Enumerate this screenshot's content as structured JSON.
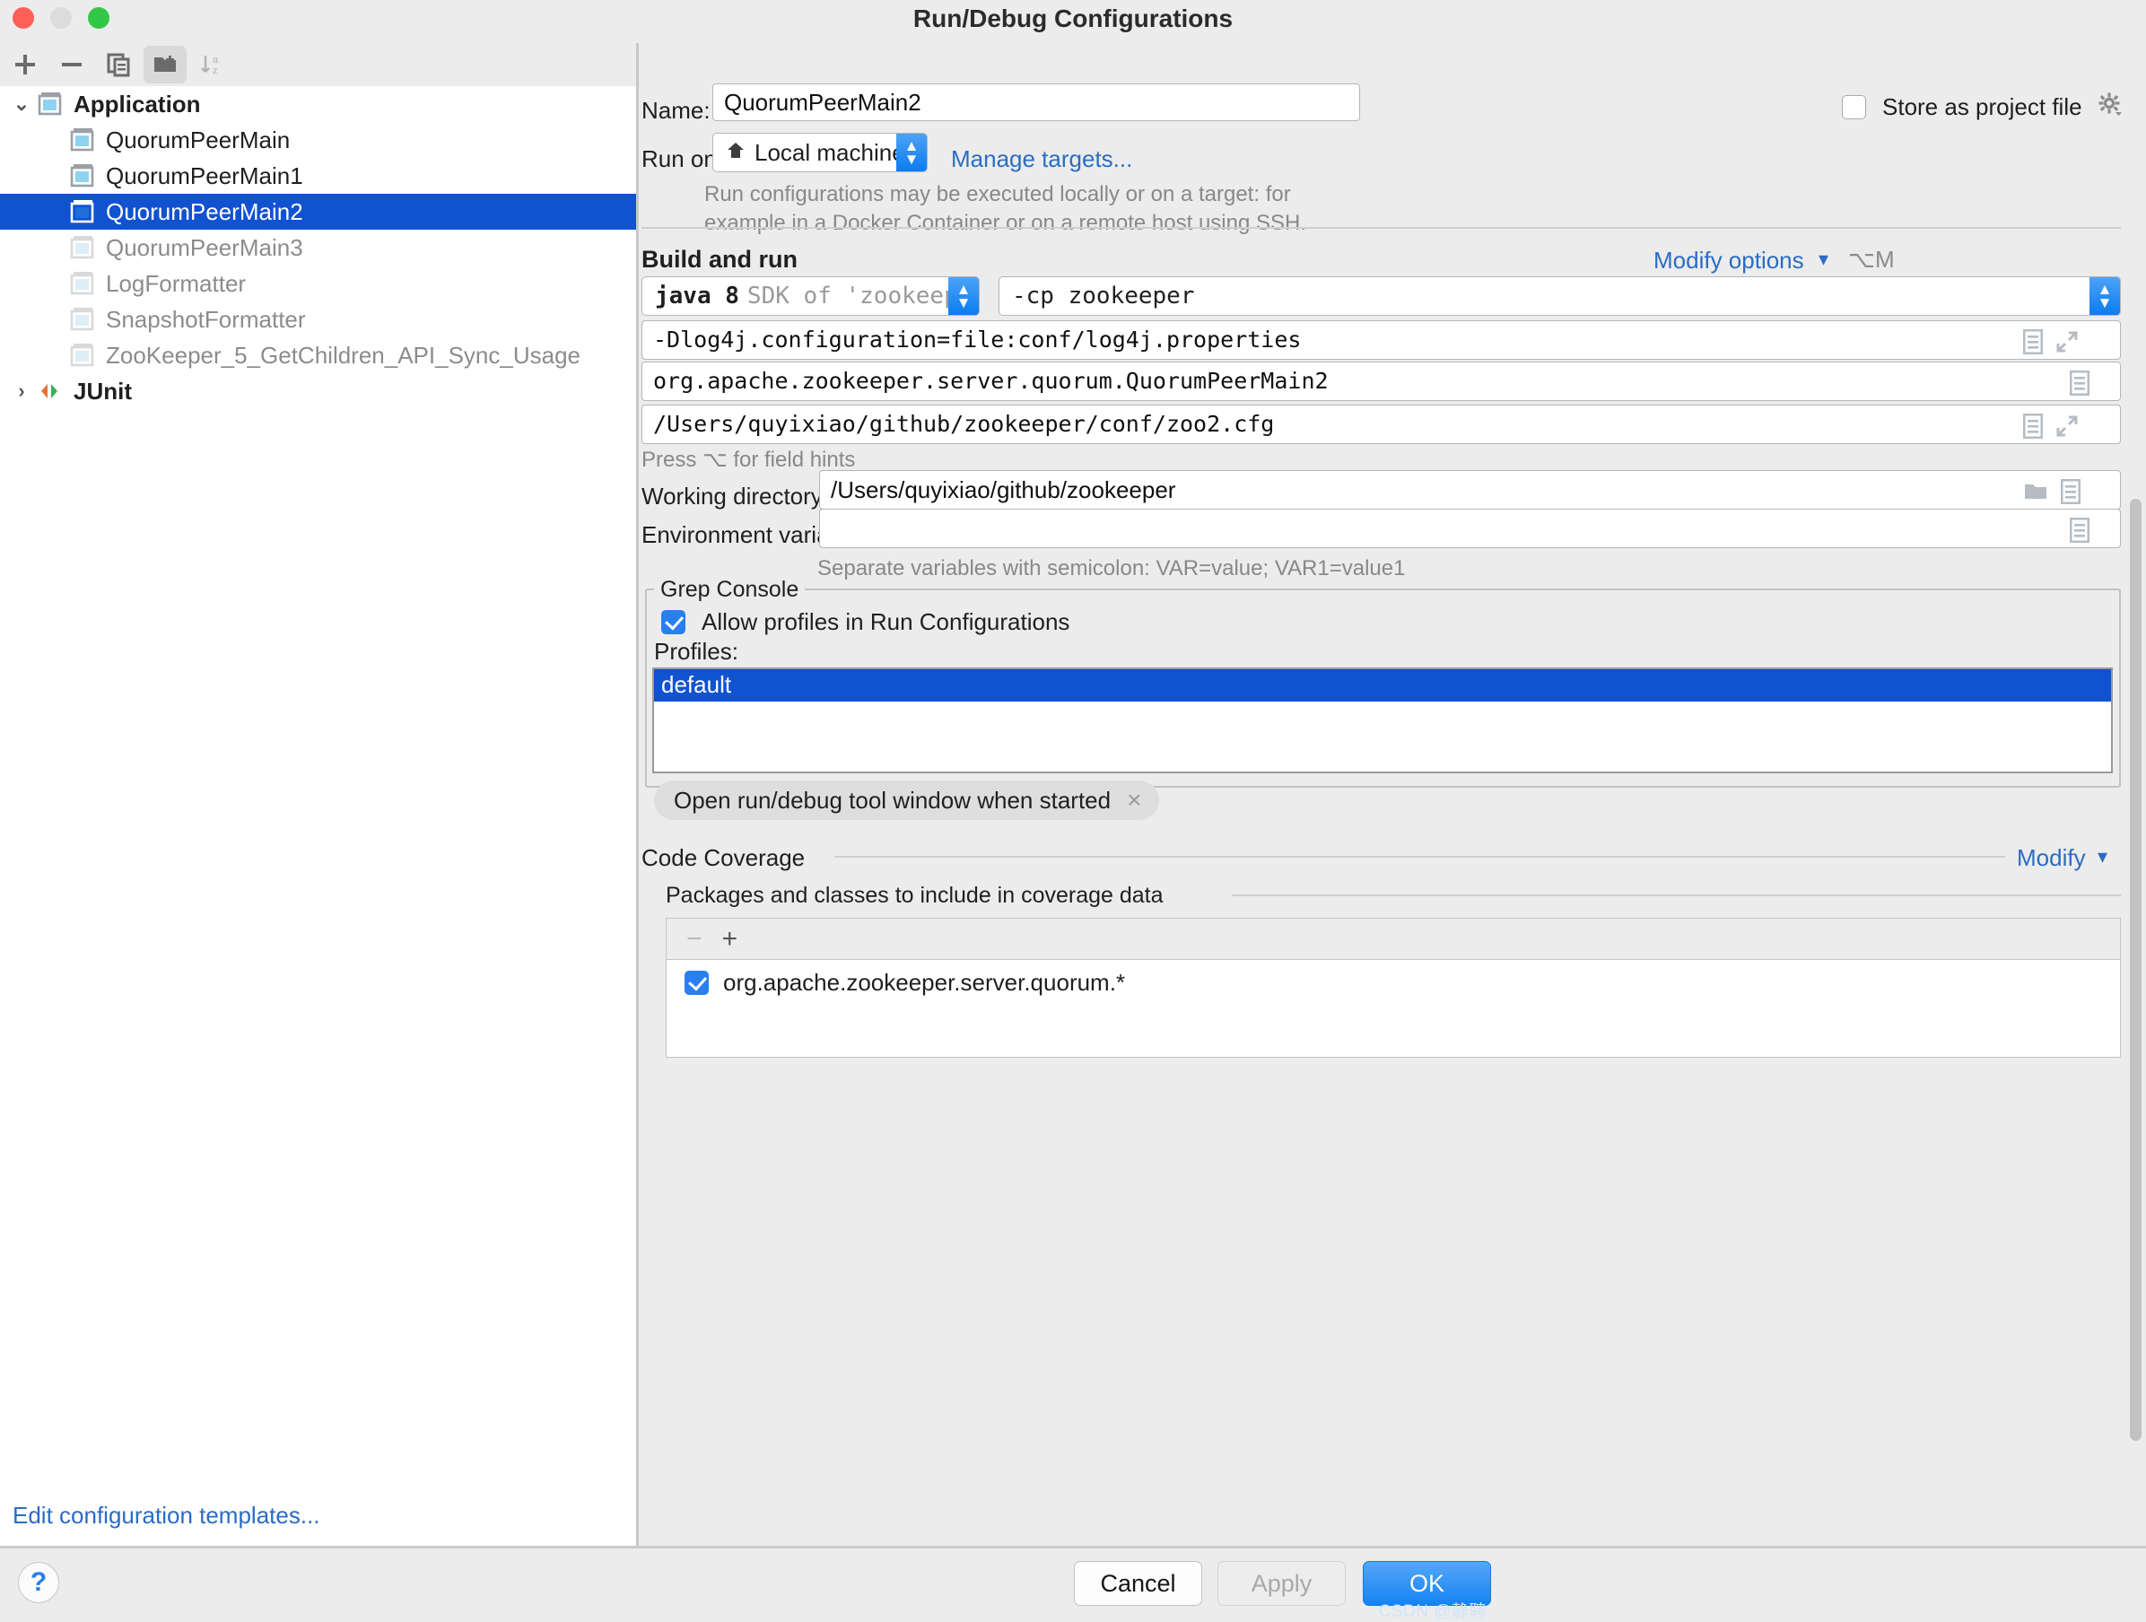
{
  "window": {
    "title": "Run/Debug Configurations",
    "traffic_lights": [
      "close",
      "minimize",
      "maximize"
    ]
  },
  "sidebar": {
    "toolbar": [
      {
        "name": "add-configuration-button",
        "icon": "plus-icon",
        "label": "+"
      },
      {
        "name": "remove-configuration-button",
        "icon": "minus-icon",
        "label": "−"
      },
      {
        "name": "copy-configuration-button",
        "icon": "copy-icon",
        "label": ""
      },
      {
        "name": "save-configuration-button",
        "icon": "folder-add-icon",
        "label": ""
      },
      {
        "name": "sort-configurations-button",
        "icon": "sort-alpha-icon",
        "label": ""
      }
    ],
    "tree": [
      {
        "label": "Application",
        "level": 0,
        "twisty": "⌄",
        "group": true,
        "selected": false,
        "dim": false,
        "icon": "application-icon"
      },
      {
        "label": "QuorumPeerMain",
        "level": 1,
        "twisty": "",
        "group": false,
        "selected": false,
        "dim": false,
        "icon": "application-icon"
      },
      {
        "label": "QuorumPeerMain1",
        "level": 1,
        "twisty": "",
        "group": false,
        "selected": false,
        "dim": false,
        "icon": "application-icon"
      },
      {
        "label": "QuorumPeerMain2",
        "level": 1,
        "twisty": "",
        "group": false,
        "selected": true,
        "dim": false,
        "icon": "application-icon"
      },
      {
        "label": "QuorumPeerMain3",
        "level": 1,
        "twisty": "",
        "group": false,
        "selected": false,
        "dim": true,
        "icon": "application-icon"
      },
      {
        "label": "LogFormatter",
        "level": 1,
        "twisty": "",
        "group": false,
        "selected": false,
        "dim": true,
        "icon": "application-icon"
      },
      {
        "label": "SnapshotFormatter",
        "level": 1,
        "twisty": "",
        "group": false,
        "selected": false,
        "dim": true,
        "icon": "application-icon"
      },
      {
        "label": "ZooKeeper_5_GetChildren_API_Sync_Usage",
        "level": 1,
        "twisty": "",
        "group": false,
        "selected": false,
        "dim": true,
        "icon": "application-icon"
      },
      {
        "label": "JUnit",
        "level": 0,
        "twisty": "›",
        "group": true,
        "selected": false,
        "dim": false,
        "icon": "junit-icon"
      }
    ],
    "edit_templates_link": "Edit configuration templates..."
  },
  "form": {
    "name_label": "Name:",
    "name_value": "QuorumPeerMain2",
    "store_as_project_file_label": "Store as project file",
    "store_as_project_file_checked": false,
    "run_on_label": "Run on:",
    "run_on_value": "Local machine",
    "manage_targets_link": "Manage targets...",
    "run_on_hint_line1": "Run configurations may be executed locally or on a target: for",
    "run_on_hint_line2": "example in a Docker Container or on a remote host using SSH.",
    "build_and_run_title": "Build and run",
    "modify_options_label": "Modify options",
    "modify_options_shortcut": "⌥M",
    "jdk_value_bold": "java 8",
    "jdk_value_dim": "SDK of 'zookeeper' module",
    "classpath_value": "-cp zookeeper",
    "vm_options_value": "-Dlog4j.configuration=file:conf/log4j.properties",
    "main_class_value": "org.apache.zookeeper.server.quorum.QuorumPeerMain2",
    "program_arguments_value": "/Users/quyixiao/github/zookeeper/conf/zoo2.cfg",
    "field_hints_text": "Press ⌥ for field hints",
    "working_directory_label": "Working directory:",
    "working_directory_value": "/Users/quyixiao/github/zookeeper",
    "environment_variables_label": "Environment variables:",
    "environment_variables_value": "",
    "environment_variables_hint": "Separate variables with semicolon: VAR=value; VAR1=value1"
  },
  "grep_console": {
    "group_label": "Grep Console",
    "allow_profiles_label": "Allow profiles in Run Configurations",
    "allow_profiles_checked": true,
    "profiles_label": "Profiles:",
    "profiles": [
      {
        "label": "default",
        "selected": true
      }
    ]
  },
  "options_chip": {
    "label": "Open run/debug tool window when started",
    "close_glyph": "×"
  },
  "code_coverage": {
    "section_label": "Code Coverage",
    "modify_label": "Modify",
    "packages_label": "Packages and classes to include in coverage data",
    "toolbar": [
      {
        "name": "remove-package-button",
        "glyph": "−"
      },
      {
        "name": "add-package-button",
        "glyph": "+"
      }
    ],
    "items": [
      {
        "label": "org.apache.zookeeper.server.quorum.*",
        "checked": true
      }
    ]
  },
  "footer": {
    "help_glyph": "?",
    "cancel_label": "Cancel",
    "apply_label": "Apply",
    "ok_label": "OK",
    "watermark": "CSDN @静聘"
  },
  "colors": {
    "accent_blue": "#1152d1",
    "link_blue": "#2a6cc4",
    "checkbox_blue": "#2a7fee",
    "panel_bg": "#ececec",
    "field_bg": "#ffffff"
  }
}
